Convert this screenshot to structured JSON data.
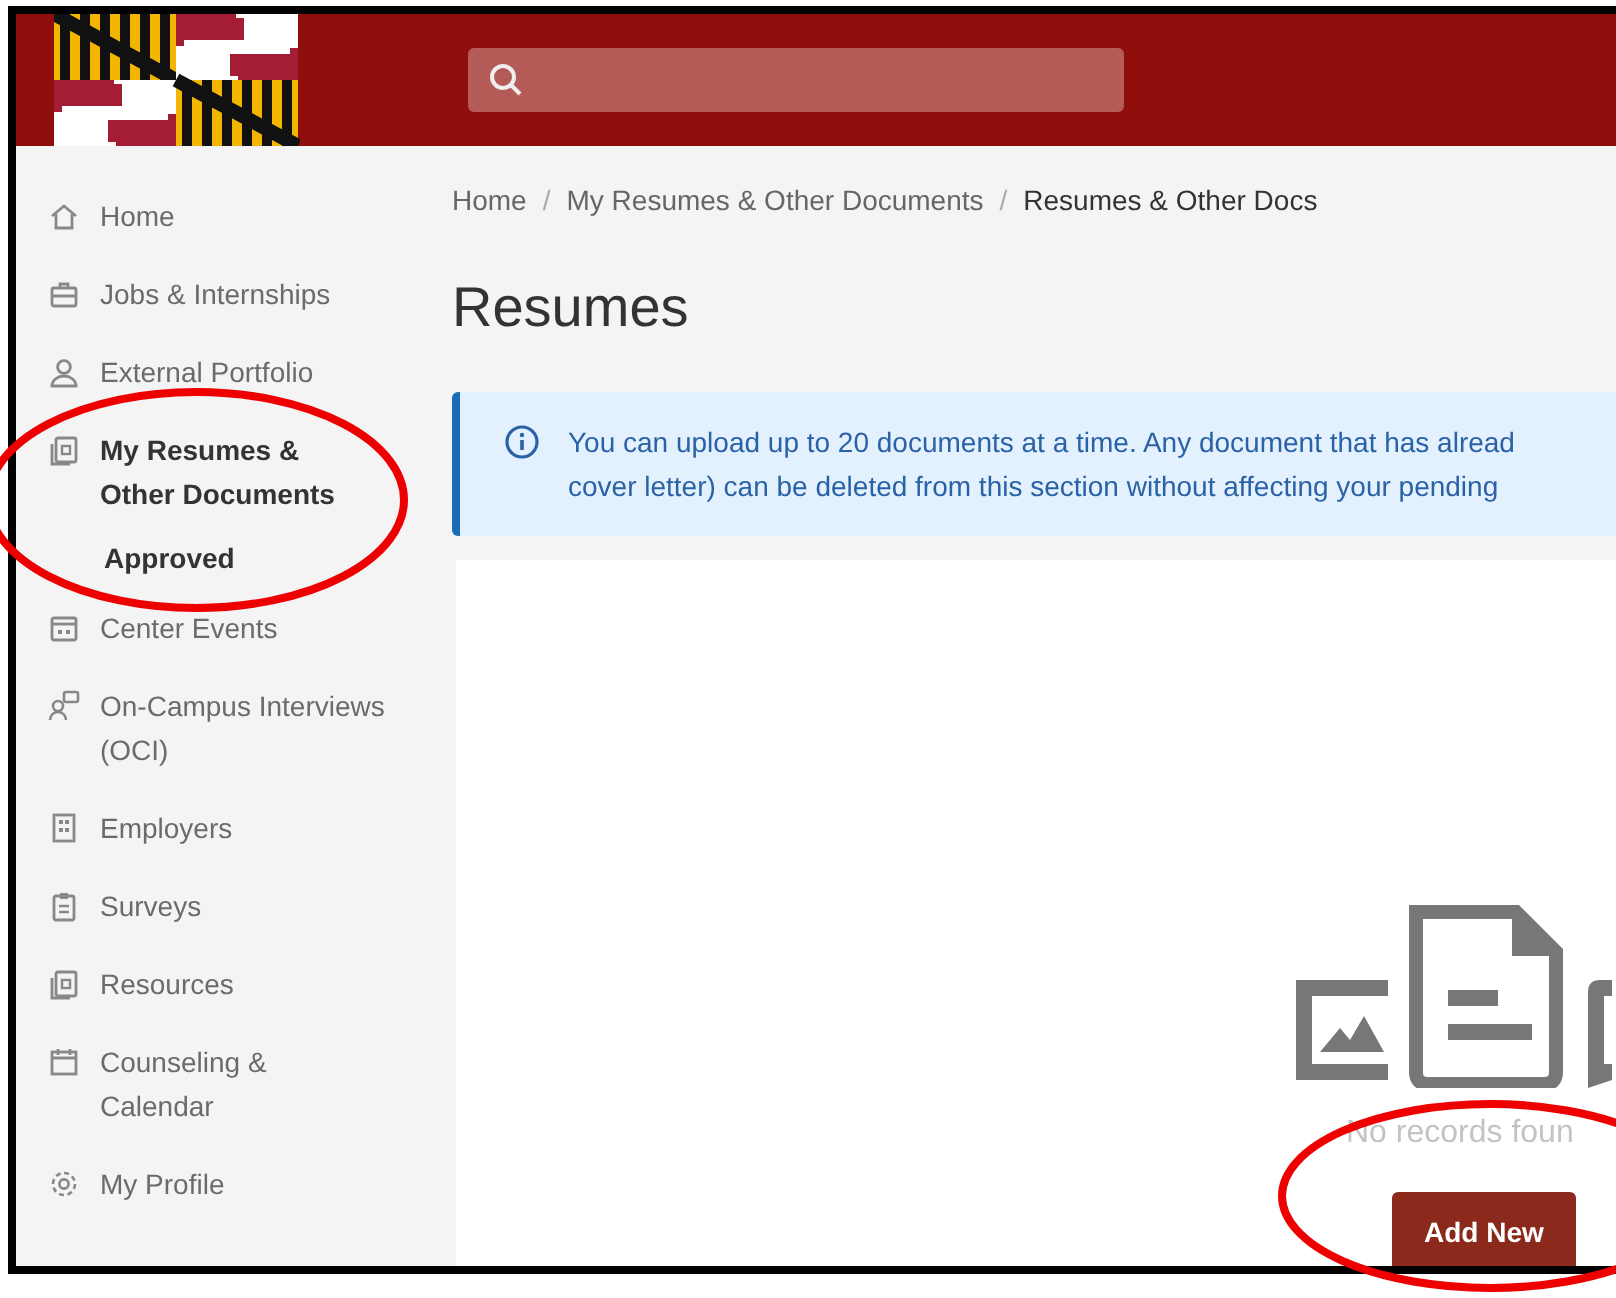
{
  "sidebar": {
    "items": [
      {
        "lines": [
          "Home"
        ],
        "selected": false
      },
      {
        "lines": [
          "Jobs & Internships"
        ],
        "selected": false
      },
      {
        "lines": [
          "External Portfolio"
        ],
        "selected": false
      },
      {
        "lines": [
          "My Resumes &",
          "Other Documents"
        ],
        "selected": true,
        "children": [
          {
            "label": "Approved",
            "selected": true
          }
        ]
      },
      {
        "lines": [
          "Center Events"
        ],
        "selected": false
      },
      {
        "lines": [
          "On-Campus Interviews",
          "(OCI)"
        ],
        "selected": false
      },
      {
        "lines": [
          "Employers"
        ],
        "selected": false
      },
      {
        "lines": [
          "Surveys"
        ],
        "selected": false
      },
      {
        "lines": [
          "Resources"
        ],
        "selected": false
      },
      {
        "lines": [
          "Counseling &",
          "Calendar"
        ],
        "selected": false
      },
      {
        "lines": [
          "My Profile"
        ],
        "selected": false
      }
    ]
  },
  "breadcrumbs": {
    "items": [
      "Home",
      "My Resumes & Other Documents",
      "Resumes & Other Docs"
    ],
    "separators": [
      "/",
      "/"
    ]
  },
  "page_title": "Resumes",
  "info_banner": {
    "lines": [
      "You can upload up to 20 documents at a time. Any document that has alread",
      "cover letter) can be deleted from this section without affecting your pending"
    ]
  },
  "empty_state": {
    "message": "No records foun",
    "button": "Add New"
  }
}
